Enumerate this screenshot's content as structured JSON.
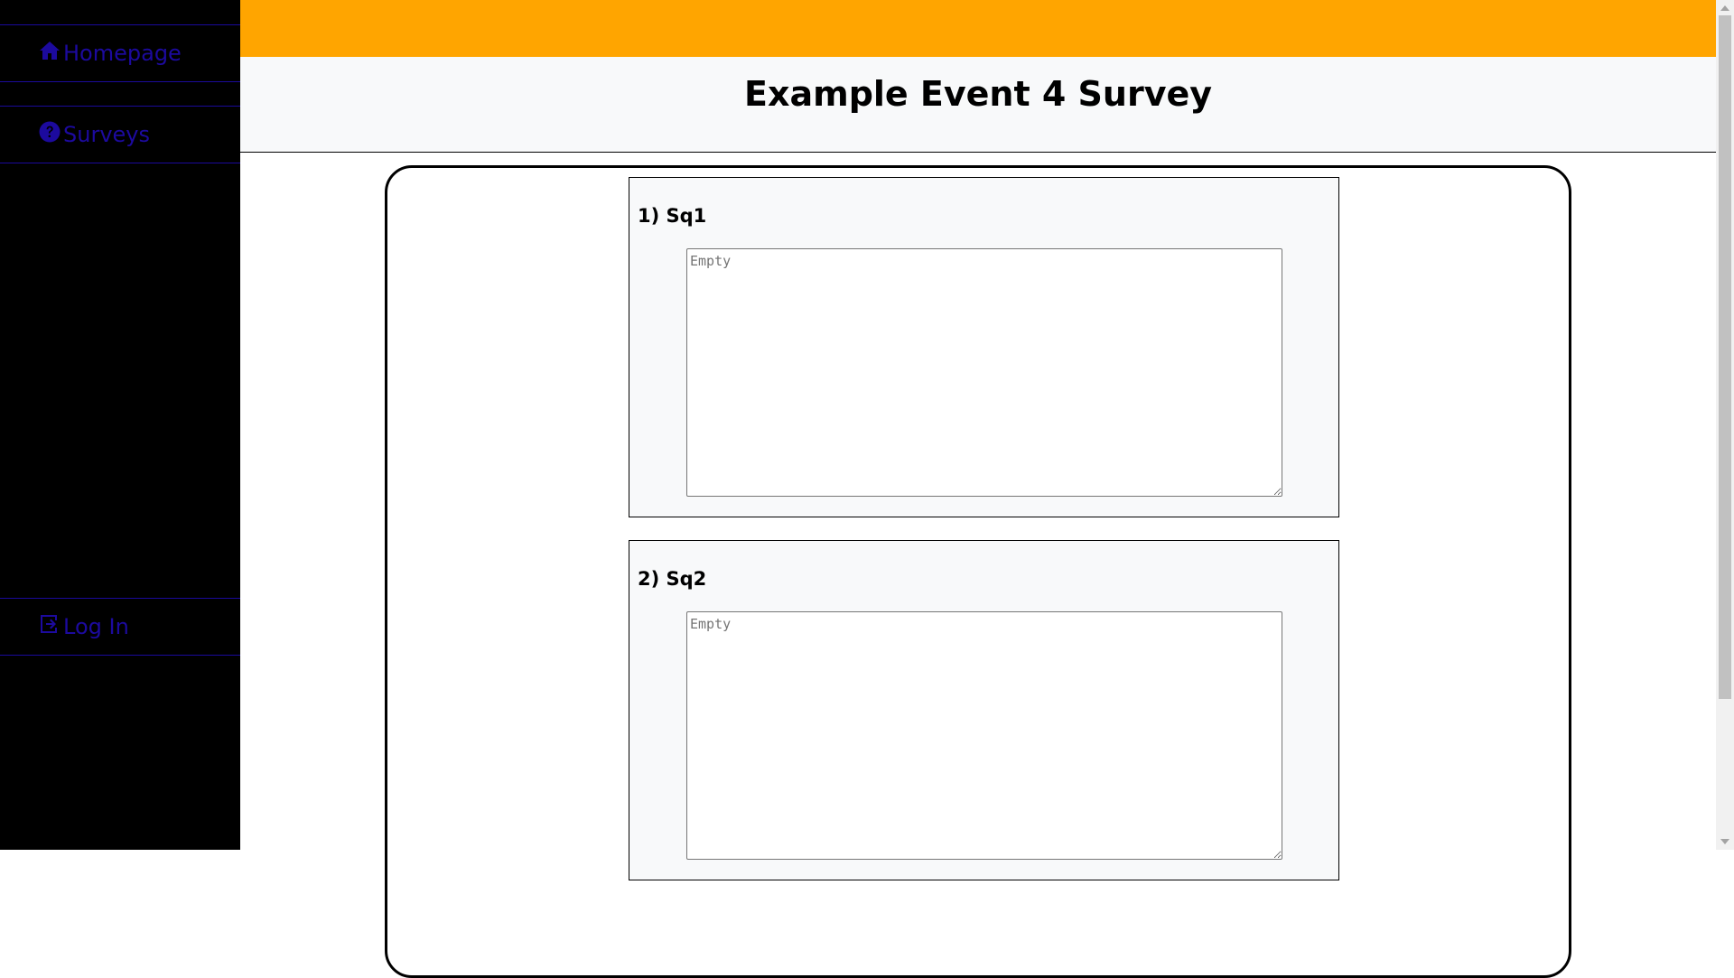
{
  "sidebar": {
    "items": [
      {
        "label": "Homepage",
        "icon": "home-icon"
      },
      {
        "label": "Surveys",
        "icon": "question-circle-icon"
      },
      {
        "label": "Log In",
        "icon": "sign-in-icon"
      }
    ],
    "link_color": "#1c0a9e",
    "background": "#000000"
  },
  "topbar": {
    "color": "#ffa500"
  },
  "header": {
    "title": "Example Event 4 Survey"
  },
  "survey": {
    "questions": [
      {
        "label": "1) Sq1",
        "placeholder": "Empty",
        "value": ""
      },
      {
        "label": "2) Sq2",
        "placeholder": "Empty",
        "value": ""
      }
    ]
  }
}
